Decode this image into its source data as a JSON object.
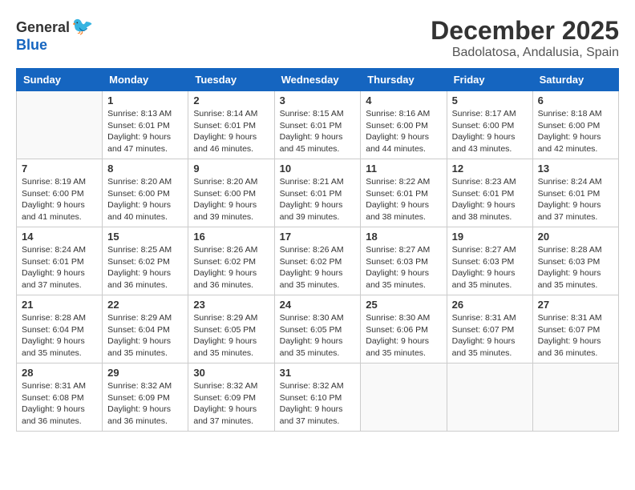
{
  "logo": {
    "general": "General",
    "blue": "Blue"
  },
  "title": "December 2025",
  "location": "Badolatosa, Andalusia, Spain",
  "weekdays": [
    "Sunday",
    "Monday",
    "Tuesday",
    "Wednesday",
    "Thursday",
    "Friday",
    "Saturday"
  ],
  "weeks": [
    [
      {
        "day": "",
        "info": ""
      },
      {
        "day": "1",
        "info": "Sunrise: 8:13 AM\nSunset: 6:01 PM\nDaylight: 9 hours\nand 47 minutes."
      },
      {
        "day": "2",
        "info": "Sunrise: 8:14 AM\nSunset: 6:01 PM\nDaylight: 9 hours\nand 46 minutes."
      },
      {
        "day": "3",
        "info": "Sunrise: 8:15 AM\nSunset: 6:01 PM\nDaylight: 9 hours\nand 45 minutes."
      },
      {
        "day": "4",
        "info": "Sunrise: 8:16 AM\nSunset: 6:00 PM\nDaylight: 9 hours\nand 44 minutes."
      },
      {
        "day": "5",
        "info": "Sunrise: 8:17 AM\nSunset: 6:00 PM\nDaylight: 9 hours\nand 43 minutes."
      },
      {
        "day": "6",
        "info": "Sunrise: 8:18 AM\nSunset: 6:00 PM\nDaylight: 9 hours\nand 42 minutes."
      }
    ],
    [
      {
        "day": "7",
        "info": "Sunrise: 8:19 AM\nSunset: 6:00 PM\nDaylight: 9 hours\nand 41 minutes."
      },
      {
        "day": "8",
        "info": "Sunrise: 8:20 AM\nSunset: 6:00 PM\nDaylight: 9 hours\nand 40 minutes."
      },
      {
        "day": "9",
        "info": "Sunrise: 8:20 AM\nSunset: 6:00 PM\nDaylight: 9 hours\nand 39 minutes."
      },
      {
        "day": "10",
        "info": "Sunrise: 8:21 AM\nSunset: 6:01 PM\nDaylight: 9 hours\nand 39 minutes."
      },
      {
        "day": "11",
        "info": "Sunrise: 8:22 AM\nSunset: 6:01 PM\nDaylight: 9 hours\nand 38 minutes."
      },
      {
        "day": "12",
        "info": "Sunrise: 8:23 AM\nSunset: 6:01 PM\nDaylight: 9 hours\nand 38 minutes."
      },
      {
        "day": "13",
        "info": "Sunrise: 8:24 AM\nSunset: 6:01 PM\nDaylight: 9 hours\nand 37 minutes."
      }
    ],
    [
      {
        "day": "14",
        "info": "Sunrise: 8:24 AM\nSunset: 6:01 PM\nDaylight: 9 hours\nand 37 minutes."
      },
      {
        "day": "15",
        "info": "Sunrise: 8:25 AM\nSunset: 6:02 PM\nDaylight: 9 hours\nand 36 minutes."
      },
      {
        "day": "16",
        "info": "Sunrise: 8:26 AM\nSunset: 6:02 PM\nDaylight: 9 hours\nand 36 minutes."
      },
      {
        "day": "17",
        "info": "Sunrise: 8:26 AM\nSunset: 6:02 PM\nDaylight: 9 hours\nand 35 minutes."
      },
      {
        "day": "18",
        "info": "Sunrise: 8:27 AM\nSunset: 6:03 PM\nDaylight: 9 hours\nand 35 minutes."
      },
      {
        "day": "19",
        "info": "Sunrise: 8:27 AM\nSunset: 6:03 PM\nDaylight: 9 hours\nand 35 minutes."
      },
      {
        "day": "20",
        "info": "Sunrise: 8:28 AM\nSunset: 6:03 PM\nDaylight: 9 hours\nand 35 minutes."
      }
    ],
    [
      {
        "day": "21",
        "info": "Sunrise: 8:28 AM\nSunset: 6:04 PM\nDaylight: 9 hours\nand 35 minutes."
      },
      {
        "day": "22",
        "info": "Sunrise: 8:29 AM\nSunset: 6:04 PM\nDaylight: 9 hours\nand 35 minutes."
      },
      {
        "day": "23",
        "info": "Sunrise: 8:29 AM\nSunset: 6:05 PM\nDaylight: 9 hours\nand 35 minutes."
      },
      {
        "day": "24",
        "info": "Sunrise: 8:30 AM\nSunset: 6:05 PM\nDaylight: 9 hours\nand 35 minutes."
      },
      {
        "day": "25",
        "info": "Sunrise: 8:30 AM\nSunset: 6:06 PM\nDaylight: 9 hours\nand 35 minutes."
      },
      {
        "day": "26",
        "info": "Sunrise: 8:31 AM\nSunset: 6:07 PM\nDaylight: 9 hours\nand 35 minutes."
      },
      {
        "day": "27",
        "info": "Sunrise: 8:31 AM\nSunset: 6:07 PM\nDaylight: 9 hours\nand 36 minutes."
      }
    ],
    [
      {
        "day": "28",
        "info": "Sunrise: 8:31 AM\nSunset: 6:08 PM\nDaylight: 9 hours\nand 36 minutes."
      },
      {
        "day": "29",
        "info": "Sunrise: 8:32 AM\nSunset: 6:09 PM\nDaylight: 9 hours\nand 36 minutes."
      },
      {
        "day": "30",
        "info": "Sunrise: 8:32 AM\nSunset: 6:09 PM\nDaylight: 9 hours\nand 37 minutes."
      },
      {
        "day": "31",
        "info": "Sunrise: 8:32 AM\nSunset: 6:10 PM\nDaylight: 9 hours\nand 37 minutes."
      },
      {
        "day": "",
        "info": ""
      },
      {
        "day": "",
        "info": ""
      },
      {
        "day": "",
        "info": ""
      }
    ]
  ]
}
